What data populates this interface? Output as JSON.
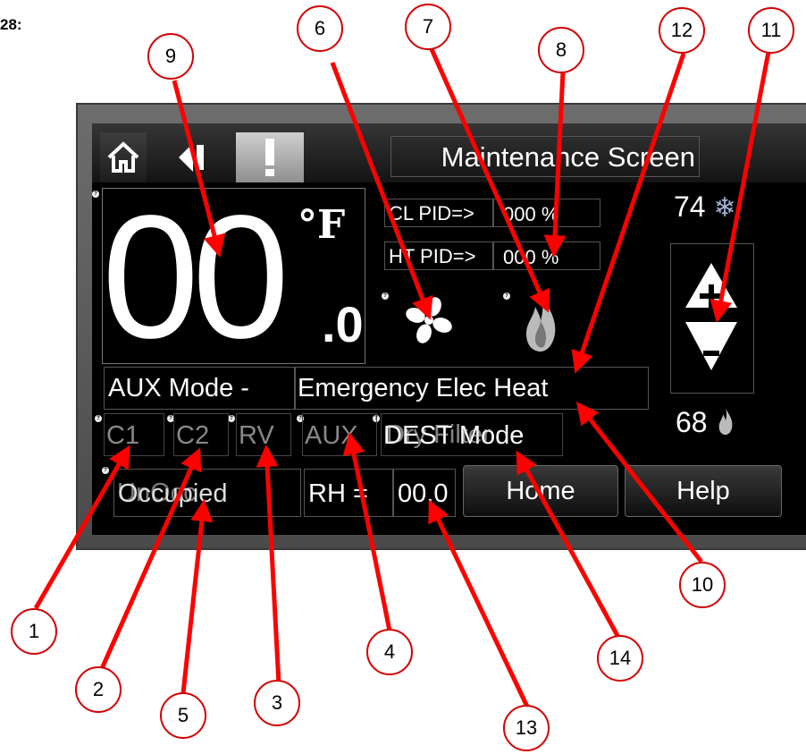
{
  "figure_label": "28:",
  "header": {
    "title": "Maintenance Screen",
    "icons": [
      "home-icon",
      "back-arrow-icon",
      "alert-icon"
    ]
  },
  "temperature": {
    "whole": "00",
    "decimal": ".0",
    "unit": "°F"
  },
  "pid": {
    "cool_label": "CL PID=>",
    "cool_value": "000 %",
    "heat_label": "HT PID=>",
    "heat_value": "000 %"
  },
  "setpoints": {
    "cool": "74",
    "heat": "68",
    "cool_icon": "snowflake-icon",
    "heat_icon": "flame-icon"
  },
  "status_icons": [
    "fan-icon",
    "flame-icon"
  ],
  "mode": {
    "label": "AUX Mode -",
    "value": "Emergency Elec Heat"
  },
  "relays": [
    "C1",
    "C2",
    "RV",
    "AUX",
    "DEST Mode"
  ],
  "relay_overlap_text": "Dry Filter",
  "bottom": {
    "occupancy": "Occupied",
    "occupancy_overlap": "UnOcc",
    "rh_label": "RH =",
    "rh_value": "00.0",
    "home_button": "Home",
    "help_button": "Help"
  },
  "callouts": [
    "1",
    "2",
    "3",
    "4",
    "5",
    "6",
    "7",
    "8",
    "9",
    "10",
    "11",
    "12",
    "13",
    "14"
  ],
  "colors": {
    "callout_ring": "#d40000",
    "arrow": "#ff0000",
    "screen_bg": "#000000",
    "bezel": "#5a5a5a"
  }
}
